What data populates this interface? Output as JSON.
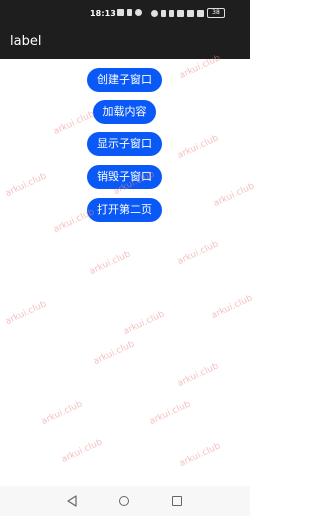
{
  "status_bar": {
    "time": "18:13",
    "battery": "38"
  },
  "app_bar": {
    "title": "label"
  },
  "buttons": {
    "create_window": "创建子窗口",
    "load_content": "加载内容",
    "show_window": "显示子窗口",
    "destroy_window": "销毁子窗口",
    "open_second_page": "打开第二页"
  },
  "watermark": {
    "text": "arkui.club"
  },
  "colors": {
    "bar_background": "#1e1e1e",
    "button_blue": "#0a59f7",
    "watermark": "#eb8c8c"
  },
  "nav_bar": {
    "back_icon": "back-triangle-icon",
    "home_icon": "home-circle-icon",
    "recent_icon": "recent-square-icon"
  }
}
